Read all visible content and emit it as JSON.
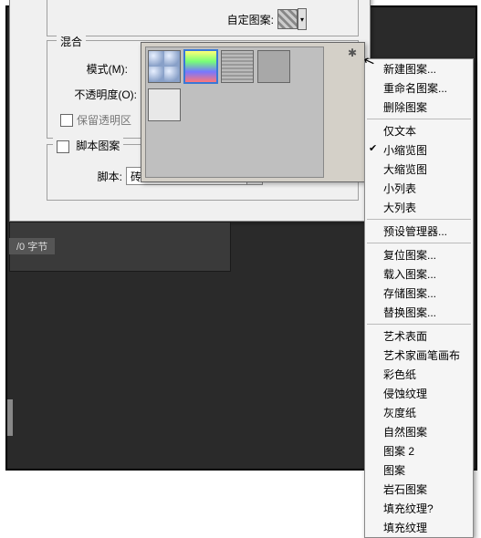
{
  "dialog": {
    "custom_pattern_label": "自定图案:",
    "blend_legend": "混合",
    "mode_label": "模式(M):",
    "opacity_label": "不透明度(O):",
    "preserve_trans_label": "保留透明区",
    "script_pattern_label": "脚本图案",
    "script_label": "脚本:",
    "script_value": "砖形填充"
  },
  "picker": {
    "thumbs": [
      "bubbles",
      "spectrum",
      "lines",
      "gray",
      "light"
    ],
    "selected_index": 1
  },
  "menu": {
    "g1": [
      "新建图案...",
      "重命名图案...",
      "删除图案"
    ],
    "g2": [
      {
        "label": "仅文本",
        "checked": false
      },
      {
        "label": "小缩览图",
        "checked": true
      },
      {
        "label": "大缩览图",
        "checked": false
      },
      {
        "label": "小列表",
        "checked": false
      },
      {
        "label": "大列表",
        "checked": false
      }
    ],
    "g3": [
      "预设管理器..."
    ],
    "g4": [
      "复位图案...",
      "载入图案...",
      "存储图案...",
      "替换图案..."
    ],
    "g5": [
      "艺术表面",
      "艺术家画笔画布",
      "彩色纸",
      "侵蚀纹理",
      "灰度纸",
      "自然图案",
      "图案 2",
      "图案",
      "岩石图案",
      "填充纹理?",
      "填充纹理"
    ]
  },
  "status": {
    "bytes": "/0 字节"
  }
}
